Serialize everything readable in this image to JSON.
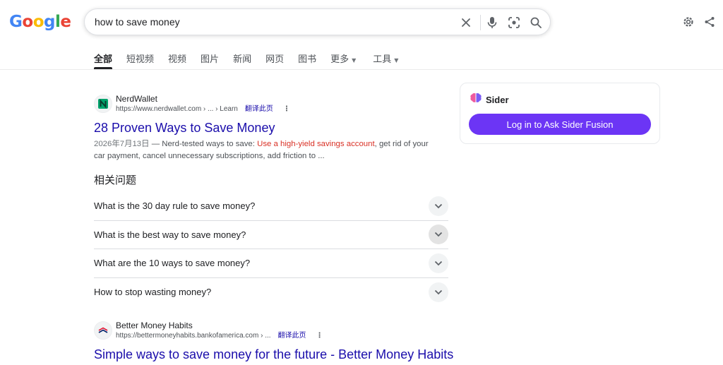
{
  "logo": {
    "letters": [
      "G",
      "o",
      "o",
      "g",
      "l",
      "e"
    ],
    "colors": [
      "#4285f4",
      "#ea4335",
      "#fbbc05",
      "#4285f4",
      "#34a853",
      "#ea4335"
    ]
  },
  "search": {
    "query": "how to save money"
  },
  "tabs": [
    {
      "label": "全部",
      "active": true
    },
    {
      "label": "短视频"
    },
    {
      "label": "视频"
    },
    {
      "label": "图片"
    },
    {
      "label": "新闻"
    },
    {
      "label": "网页"
    },
    {
      "label": "图书"
    },
    {
      "label": "更多",
      "caret": "▼"
    },
    {
      "label": "工具",
      "caret": "▼"
    }
  ],
  "results": [
    {
      "site_name": "NerdWallet",
      "url": "https://www.nerdwallet.com › ... › Learn",
      "translate": "翻译此页",
      "title": "28 Proven Ways to Save Money",
      "date": "2026年7月13日",
      "snippet_pre": " — Nerd-tested ways to save: ",
      "snippet_hl": "Use a high-yield savings account",
      "snippet_post": ", get rid of your car payment, cancel unnecessary subscriptions, add friction to ..."
    },
    {
      "site_name": "Better Money Habits",
      "url": "https://bettermoneyhabits.bankofamerica.com › ...",
      "translate": "翻译此页",
      "title": "Simple ways to save money for the future - Better Money Habits"
    }
  ],
  "paa": {
    "title": "相关问题",
    "questions": [
      "What is the 30 day rule to save money?",
      "What is the best way to save money?",
      "What are the 10 ways to save money?",
      "How to stop wasting money?"
    ]
  },
  "sider": {
    "name": "Sider",
    "button": "Log in to Ask Sider Fusion",
    "accent": "#6c35f5"
  }
}
